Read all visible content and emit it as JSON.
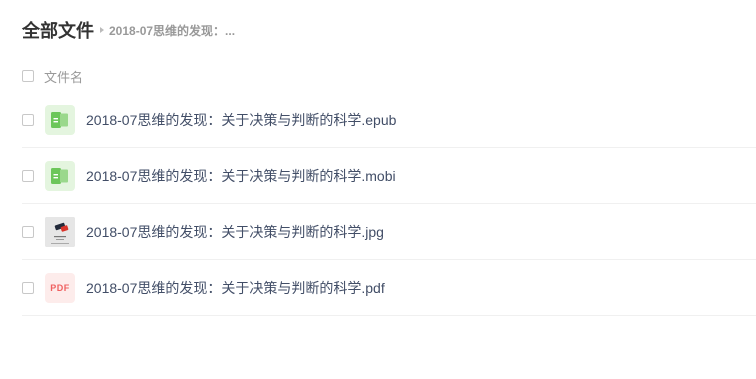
{
  "breadcrumb": {
    "root": "全部文件",
    "current": "2018-07思维的发现：..."
  },
  "list_header": {
    "name_column": "文件名"
  },
  "files": [
    {
      "name": "2018-07思维的发现：关于决策与判断的科学.epub",
      "icon": "book-icon"
    },
    {
      "name": "2018-07思维的发现：关于决策与判断的科学.mobi",
      "icon": "book-icon"
    },
    {
      "name": "2018-07思维的发现：关于决策与判断的科学.jpg",
      "icon": "image-thumbnail-icon"
    },
    {
      "name": "2018-07思维的发现：关于决策与判断的科学.pdf",
      "icon": "pdf-icon",
      "icon_text": "PDF"
    }
  ],
  "colors": {
    "book_icon_green": "#6cc65a",
    "pdf_red": "#f06060",
    "text_primary": "#424e67"
  }
}
